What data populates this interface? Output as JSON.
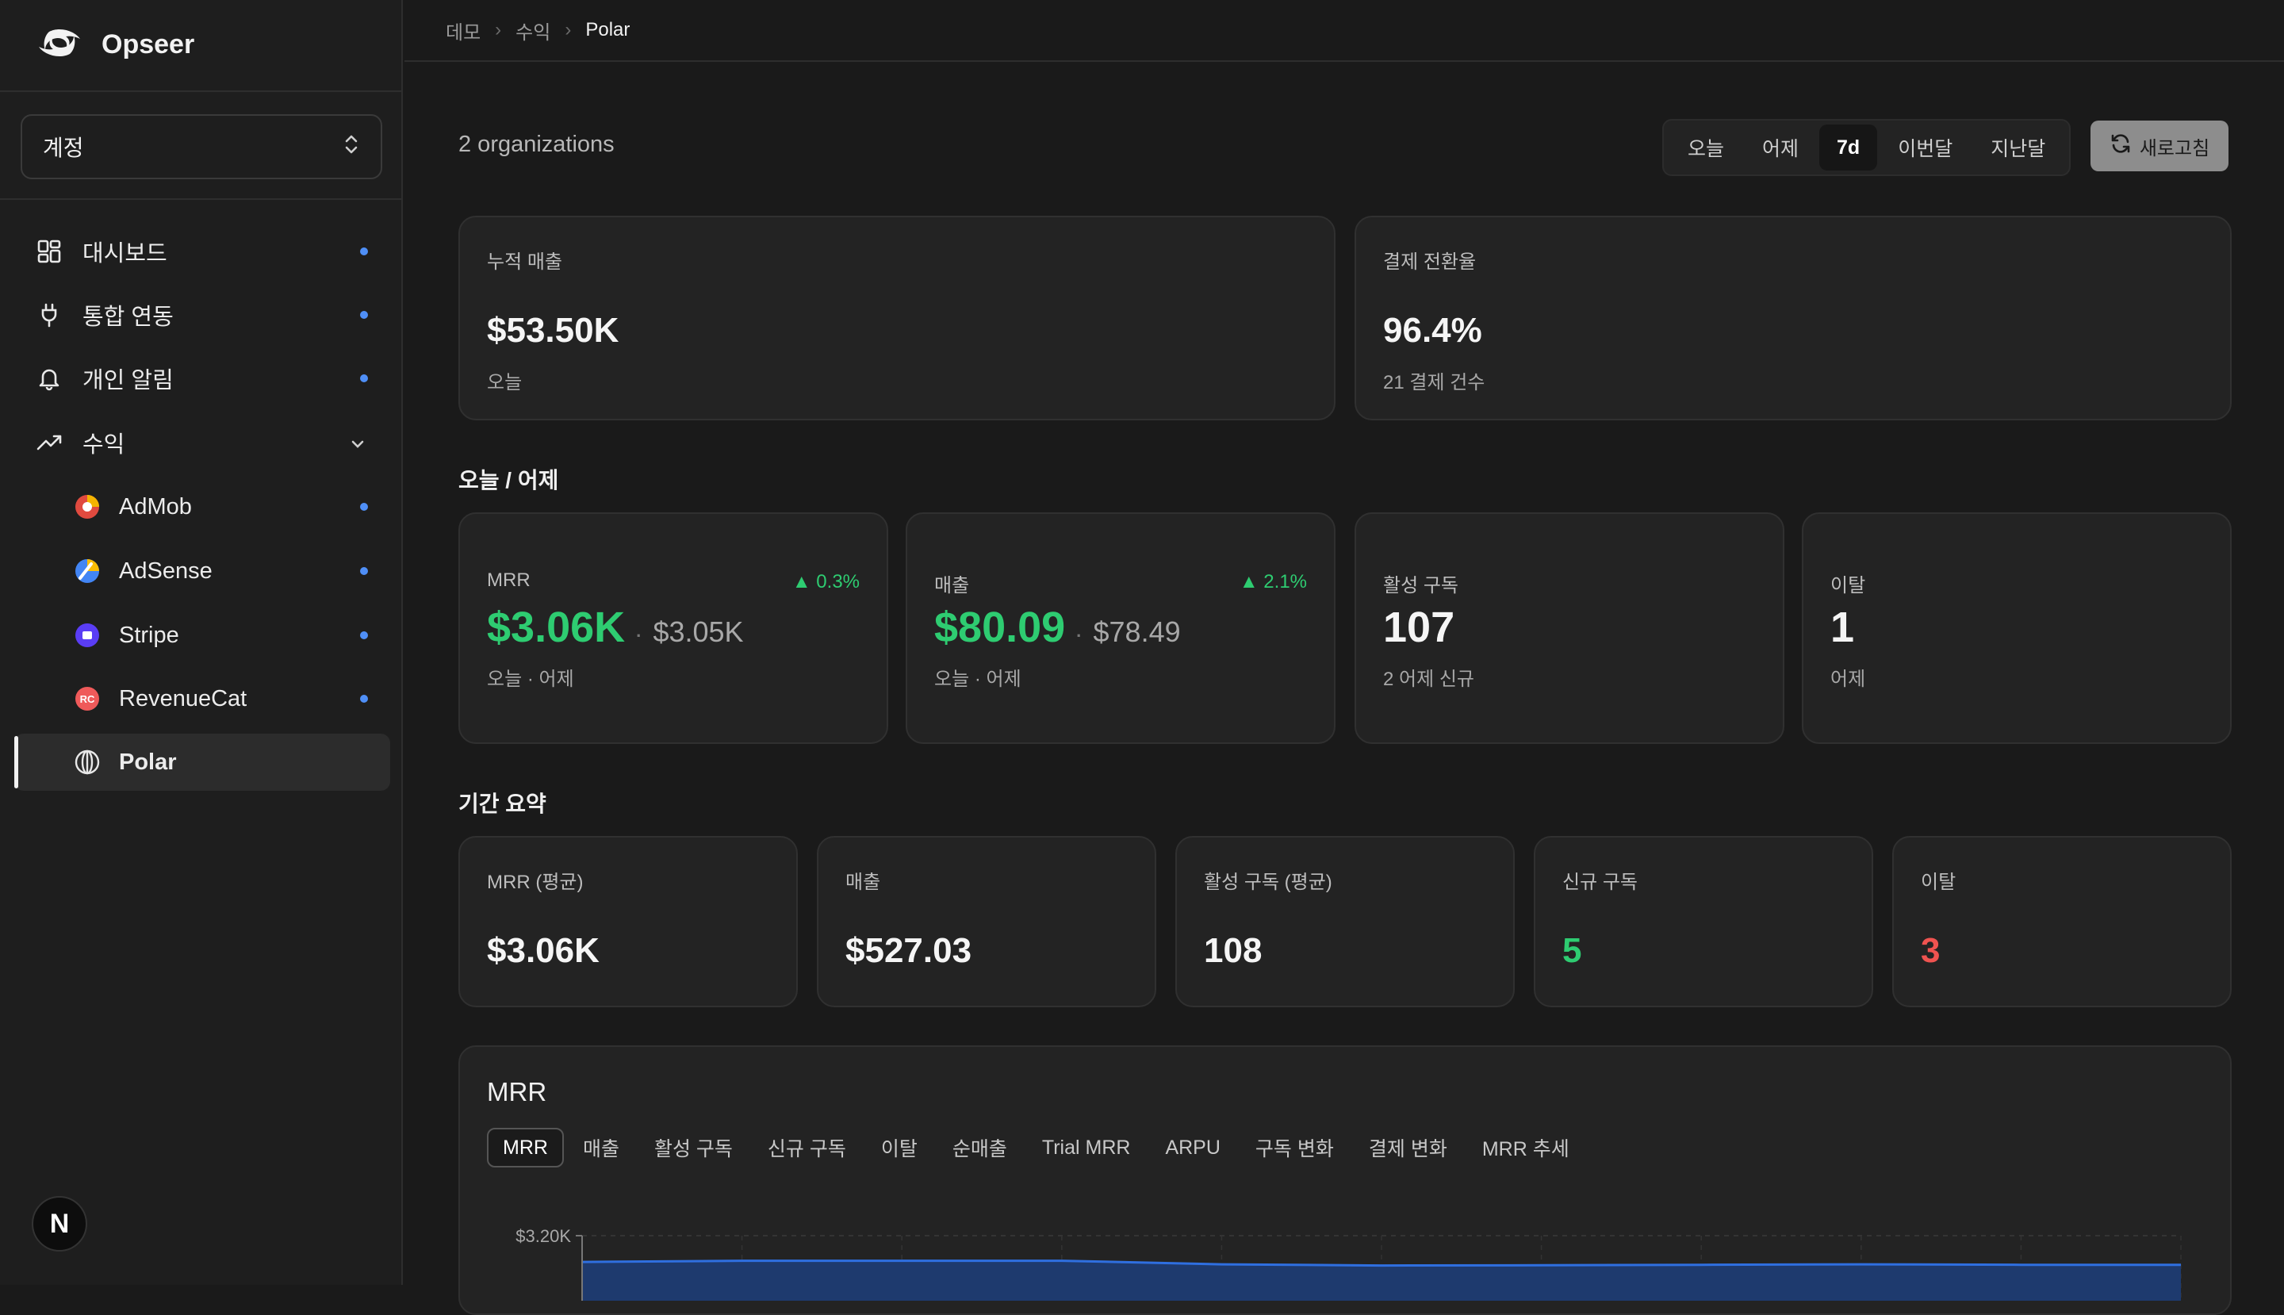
{
  "brand": {
    "name": "Opseer"
  },
  "account": {
    "label": "계정"
  },
  "nav": {
    "items": [
      {
        "label": "대시보드"
      },
      {
        "label": "통합 연동"
      },
      {
        "label": "개인 알림"
      },
      {
        "label": "수익"
      }
    ],
    "sub_items": [
      {
        "label": "AdMob"
      },
      {
        "label": "AdSense"
      },
      {
        "label": "Stripe"
      },
      {
        "label": "RevenueCat"
      },
      {
        "label": "Polar"
      }
    ]
  },
  "avatar": {
    "letter": "N"
  },
  "breadcrumb": [
    "데모",
    "수익",
    "Polar"
  ],
  "org_count": "2 organizations",
  "range": {
    "options": [
      "오늘",
      "어제",
      "7d",
      "이번달",
      "지난달"
    ],
    "selected": "7d"
  },
  "refresh_label": "새로고침",
  "top_cards": [
    {
      "label": "누적 매출",
      "value": "$53.50K",
      "sub": "오늘"
    },
    {
      "label": "결제 전환율",
      "value": "96.4%",
      "sub": "21 결제 건수"
    }
  ],
  "today_section": {
    "title": "오늘 / 어제",
    "cards": [
      {
        "label": "MRR",
        "delta": "▲ 0.3%",
        "value": "$3.06K",
        "prev": "$3.05K",
        "sub": "오늘 · 어제"
      },
      {
        "label": "매출",
        "delta": "▲ 2.1%",
        "value": "$80.09",
        "prev": "$78.49",
        "sub": "오늘 · 어제"
      },
      {
        "label": "활성 구독",
        "value": "107",
        "sub": "2 어제 신규"
      },
      {
        "label": "이탈",
        "value": "1",
        "sub": "어제"
      }
    ]
  },
  "period_section": {
    "title": "기간 요약",
    "cards": [
      {
        "label": "MRR (평균)",
        "value": "$3.06K"
      },
      {
        "label": "매출",
        "value": "$527.03"
      },
      {
        "label": "활성 구독 (평균)",
        "value": "108"
      },
      {
        "label": "신규 구독",
        "value": "5"
      },
      {
        "label": "이탈",
        "value": "3"
      }
    ]
  },
  "chart": {
    "title": "MRR",
    "tabs": [
      "MRR",
      "매출",
      "활성 구독",
      "신규 구독",
      "이탈",
      "순매출",
      "Trial MRR",
      "ARPU",
      "구독 변화",
      "결제 변화",
      "MRR 추세"
    ],
    "selected_tab": "MRR"
  },
  "chart_data": {
    "type": "area",
    "title": "MRR",
    "y_tick_labels": [
      "$3.20K"
    ],
    "values": [
      3.09,
      3.095,
      3.095,
      3.095,
      3.08,
      3.075,
      3.076,
      3.078,
      3.08,
      3.078,
      3.078
    ],
    "ylim": [
      0,
      3.2
    ],
    "grid": true
  },
  "colors": {
    "accent_positive": "#2ecc71",
    "accent_negative": "#ef5350",
    "dot": "#4f8ff7",
    "area_fill": "#1e3a6e",
    "area_line": "#2f6fe0"
  }
}
